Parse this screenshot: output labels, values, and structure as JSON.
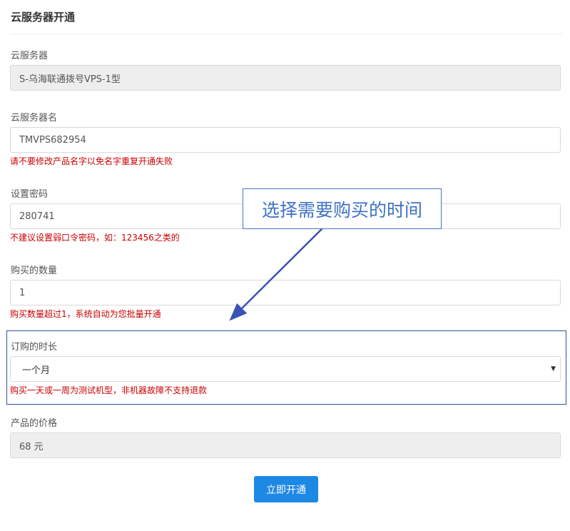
{
  "page": {
    "title": "云服务器开通"
  },
  "fields": {
    "server": {
      "label": "云服务器",
      "value": "S-乌海联通拨号VPS-1型"
    },
    "server_name": {
      "label": "云服务器名",
      "value": "TMVPS682954",
      "hint": "请不要修改产品名字以免名字重复开通失败"
    },
    "password": {
      "label": "设置密码",
      "value": "280741",
      "hint": "不建议设置弱口令密码，如：123456之类的"
    },
    "quantity": {
      "label": "购买的数量",
      "value": "1",
      "hint": "购买数量超过1，系统自动为您批量开通"
    },
    "duration": {
      "label": "订购的时长",
      "selected": "一个月",
      "hint": "购买一天或一周为测试机型，非机器故障不支持退款"
    },
    "price": {
      "label": "产品的价格",
      "value": "68 元"
    }
  },
  "annotation": {
    "callout_text": "选择需要购买的时间",
    "color": "#3f72c4"
  },
  "actions": {
    "submit_label": "立即开通"
  },
  "colors": {
    "primary": "#1e88e5",
    "hint": "#cc0000",
    "highlight_border": "#2d4fa0"
  }
}
